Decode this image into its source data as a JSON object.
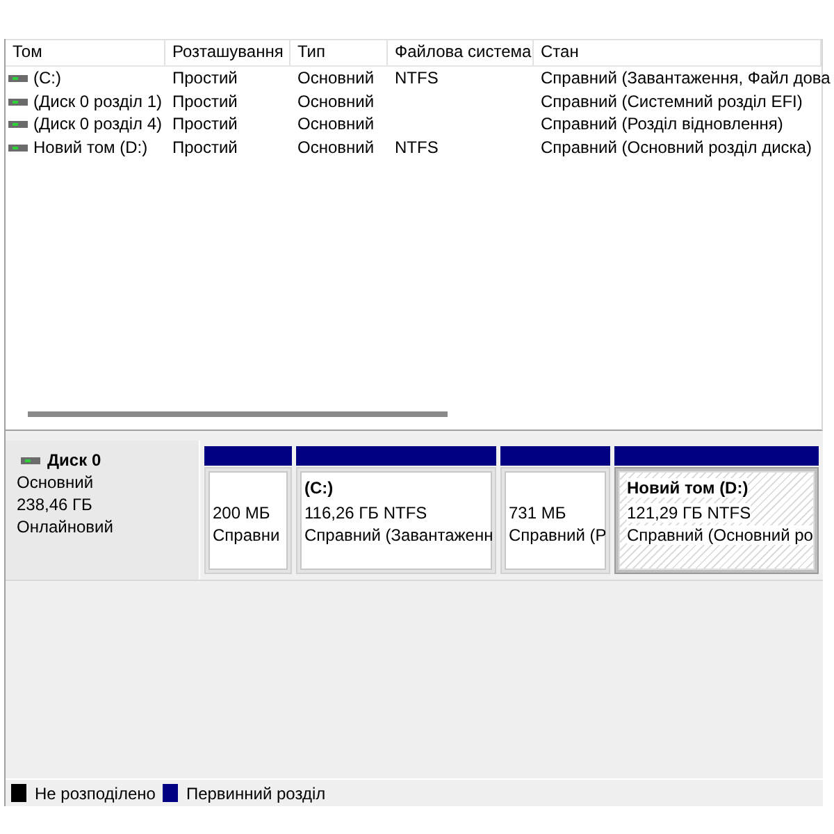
{
  "volume_table": {
    "columns": [
      "Том",
      "Розташування",
      "Тип",
      "Файлова система",
      "Стан"
    ],
    "rows": [
      {
        "cells": [
          "(C:)",
          "Простий",
          "Основний",
          "NTFS",
          "Справний (Завантаження, Файл дова"
        ]
      },
      {
        "cells": [
          "(Диск 0 розділ 1)",
          "Простий",
          "Основний",
          "",
          "Справний (Системний розділ EFI)"
        ]
      },
      {
        "cells": [
          "(Диск 0 розділ 4)",
          "Простий",
          "Основний",
          "",
          "Справний (Розділ відновлення)"
        ]
      },
      {
        "cells": [
          "Новий том (D:)",
          "Простий",
          "Основний",
          "NTFS",
          "Справний (Основний розділ диска)"
        ]
      }
    ]
  },
  "disk": {
    "name": "Диск 0",
    "type": "Основний",
    "size": "238,46 ГБ",
    "status": "Онлайновий",
    "partitions": [
      {
        "size": "200 МБ",
        "status": "Справни",
        "selected": false
      },
      {
        "name": "(C:)",
        "size": "116,26 ГБ NTFS",
        "status": "Справний (Завантаженн",
        "selected": false
      },
      {
        "size": "731 МБ",
        "status": "Справний (Р",
        "selected": false
      },
      {
        "name": "Новий том  (D:)",
        "size": "121,29 ГБ NTFS",
        "status": "Справний (Основний ро",
        "selected": true
      }
    ]
  },
  "legend": [
    {
      "label": "Не розподілено",
      "color": "#000000"
    },
    {
      "label": "Первинний розділ",
      "color": "#000080"
    }
  ]
}
